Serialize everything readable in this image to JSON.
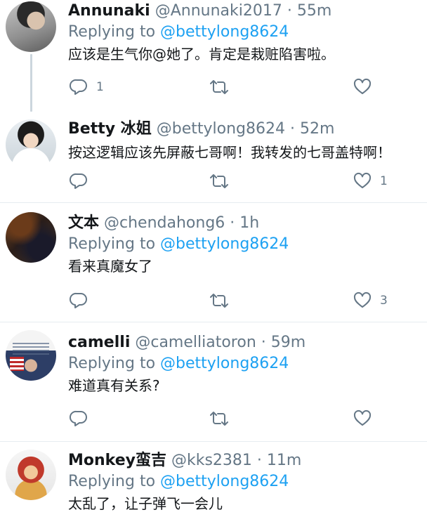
{
  "tweets": [
    {
      "display_name": "Annunaki",
      "handle": "@Annunaki2017",
      "time": "55m",
      "replying_label": "Replying to",
      "replying_to": "@bettylong8624",
      "text": "应该是生气你@她了。肯定是栽赃陷害啦。",
      "reply_count": "1",
      "retweet_count": "",
      "like_count": ""
    },
    {
      "display_name": "Betty 冰姐",
      "handle": "@bettylong8624",
      "time": "52m",
      "text": "按这逻辑应该先屏蔽七哥啊！我转发的七哥盖特啊！",
      "reply_count": "",
      "retweet_count": "",
      "like_count": "1"
    },
    {
      "display_name": "文本",
      "handle": "@chendahong6",
      "time": "1h",
      "replying_label": "Replying to",
      "replying_to": "@bettylong8624",
      "text": "看来真魔女了",
      "reply_count": "",
      "retweet_count": "",
      "like_count": "3"
    },
    {
      "display_name": "camelli",
      "handle": "@camelliatoron",
      "time": "59m",
      "replying_label": "Replying to",
      "replying_to": "@bettylong8624",
      "text": "难道真有关系?",
      "reply_count": "",
      "retweet_count": "",
      "like_count": ""
    },
    {
      "display_name": "Monkey蛮吉",
      "handle": "@kks2381",
      "time": "11m",
      "replying_label": "Replying to",
      "replying_to": "@bettylong8624",
      "text": "太乱了，让子弹飞一会儿"
    }
  ],
  "separator": "·",
  "icons": {
    "reply": "reply-icon",
    "retweet": "retweet-icon",
    "like": "heart-icon"
  },
  "colors": {
    "text": "#14171a",
    "secondary": "#657786",
    "link": "#1da1f2",
    "divider": "#e6ecf0",
    "thread_line": "#ccd6dd"
  }
}
